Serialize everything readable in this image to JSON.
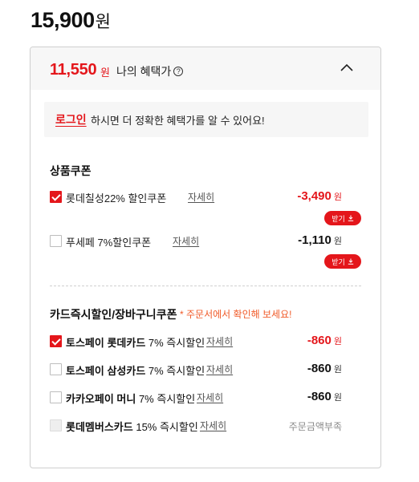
{
  "price": {
    "value": "15,900",
    "unit": "원"
  },
  "benefit": {
    "price": "11,550",
    "unit": "원",
    "label": "나의 혜택가",
    "help_icon": "question-circle-icon",
    "collapse_icon": "chevron-up-icon"
  },
  "login_notice": {
    "link": "로그인",
    "text": "하시면 더 정확한 혜택가를 알 수 있어요!"
  },
  "product_coupons": {
    "title": "상품쿠폰",
    "items": [
      {
        "checked": true,
        "label": "롯데칠성22% 할인쿠폰",
        "detail": "자세히",
        "amount": "-3,490",
        "unit": "원",
        "download_label": "받기",
        "download_icon": "download-icon"
      },
      {
        "checked": false,
        "label": "푸세페 7%할인쿠폰",
        "detail": "자세히",
        "amount": "-1,110",
        "unit": "원",
        "download_label": "받기",
        "download_icon": "download-icon"
      }
    ]
  },
  "card_discounts": {
    "title": "카드즉시할인/장바구니쿠폰",
    "note": "* 주문서에서 확인해 보세요!",
    "items": [
      {
        "checked": true,
        "name": "토스페이 롯데카드",
        "rest": " 7% 즉시할인",
        "detail": "자세히",
        "amount": "-860",
        "unit": "원"
      },
      {
        "checked": false,
        "name": "토스페이 삼성카드",
        "rest": " 7% 즉시할인",
        "detail": "자세히",
        "amount": "-860",
        "unit": "원"
      },
      {
        "checked": false,
        "name": "카카오페이 머니",
        "rest": " 7% 즉시할인",
        "detail": "자세히",
        "amount": "-860",
        "unit": "원"
      },
      {
        "checked": false,
        "disabled": true,
        "name": "롯데멤버스카드",
        "rest": " 15% 즉시할인",
        "detail": "자세히",
        "status": "주문금액부족"
      }
    ]
  },
  "colors": {
    "accent": "#e4161b",
    "note": "#f05a28",
    "panel_border": "#cfcfcf",
    "header_bg": "#f7f7f7"
  }
}
